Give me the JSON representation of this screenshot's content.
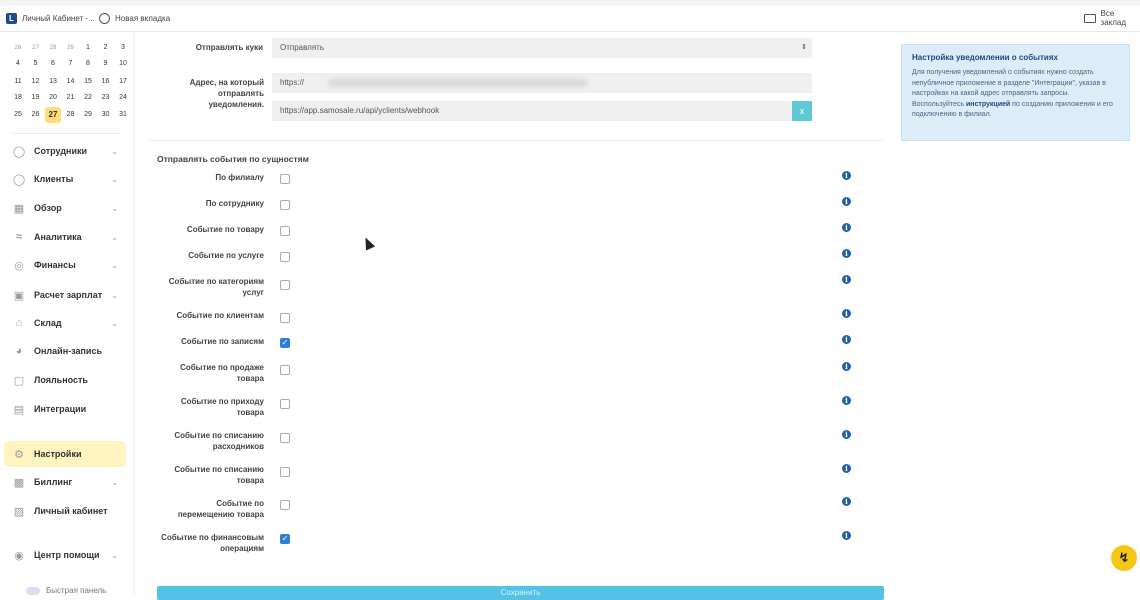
{
  "bookmarks": {
    "items": [
      {
        "label": "Личный Кабинет -...",
        "icon": "yclients-favicon"
      },
      {
        "label": "Новая вкладка",
        "icon": "globe-icon"
      }
    ],
    "all_bookmarks": "Все заклад"
  },
  "calendar": {
    "rows": [
      [
        "26",
        "27",
        "28",
        "29",
        "1",
        "2",
        "3"
      ],
      [
        "4",
        "5",
        "6",
        "7",
        "8",
        "9",
        "10"
      ],
      [
        "11",
        "12",
        "13",
        "14",
        "15",
        "16",
        "17"
      ],
      [
        "18",
        "19",
        "20",
        "21",
        "22",
        "23",
        "24"
      ],
      [
        "25",
        "26",
        "27",
        "28",
        "29",
        "30",
        "31"
      ]
    ],
    "today": "27"
  },
  "sidebar": {
    "items": [
      {
        "label": "Сотрудники",
        "icon": "user-icon",
        "chevron": true
      },
      {
        "label": "Клиенты",
        "icon": "users-icon",
        "chevron": true
      },
      {
        "label": "Обзор",
        "icon": "grid-icon",
        "chevron": true
      },
      {
        "label": "Аналитика",
        "icon": "chart-icon",
        "chevron": true
      },
      {
        "label": "Финансы",
        "icon": "coin-icon",
        "chevron": true
      },
      {
        "label": "Расчет зарплат",
        "icon": "calculator-icon",
        "chevron": true
      },
      {
        "label": "Склад",
        "icon": "warehouse-icon",
        "chevron": true
      },
      {
        "label": "Онлайн-запись",
        "icon": "globe-icon",
        "chevron": false
      },
      {
        "label": "Лояльность",
        "icon": "loyalty-icon",
        "chevron": false
      },
      {
        "label": "Интеграции",
        "icon": "integration-icon",
        "chevron": false
      },
      {
        "label": "Настройки",
        "icon": "gear-icon",
        "chevron": false,
        "active": true
      },
      {
        "label": "Биллинг",
        "icon": "billing-icon",
        "chevron": true
      },
      {
        "label": "Личный кабинет",
        "icon": "cabinet-icon",
        "chevron": false
      },
      {
        "label": "Центр помощи",
        "icon": "help-icon",
        "chevron": true
      }
    ],
    "quick_panel": "Быстрая панель"
  },
  "form": {
    "send_cookies_label": "Отправлять куки",
    "send_cookies_value": "Отправлять",
    "address_label": "Адрес, на который отправлять уведомления.",
    "address_value_1": "https://",
    "address_value_2": "https://app.samosale.ru/api/yclients/webhook",
    "remove_button": "x",
    "section_title": "Отправлять события по сущностям",
    "events": [
      {
        "label": "По филиалу",
        "checked": false
      },
      {
        "label": "По сотруднику",
        "checked": false
      },
      {
        "label": "Событие по товару",
        "checked": false
      },
      {
        "label": "Событие по услуге",
        "checked": false
      },
      {
        "label": "Событие по категориям услуг",
        "checked": false
      },
      {
        "label": "Событие по клиентам",
        "checked": false
      },
      {
        "label": "Событие по записям",
        "checked": true
      },
      {
        "label": "Событие по продаже товара",
        "checked": false
      },
      {
        "label": "Событие по приходу товара",
        "checked": false
      },
      {
        "label": "Событие по списанию расходников",
        "checked": false
      },
      {
        "label": "Событие по списанию товара",
        "checked": false
      },
      {
        "label": "Событие по перемещению товара",
        "checked": false
      },
      {
        "label": "Событие по финансовым операциям",
        "checked": true
      }
    ],
    "save_label": "Сохранить"
  },
  "info_panel": {
    "title": "Настройка уведомлении о событиях",
    "text_before": "Для получения уведомлений о событиях нужно создать непубличное приложение в разделе \"Интеграции\", указав в настройках на какой адрес отправлять запросы. Воспользуйтесь ",
    "link": "инструкцией",
    "text_after": " по созданию приложения и его подключению в филиал."
  },
  "colors": {
    "accent": "#2f7ed8",
    "active_nav": "#fff3c0",
    "info_bg": "#dcecf9",
    "save_button": "#53c2e6",
    "fab": "#f5c518"
  }
}
